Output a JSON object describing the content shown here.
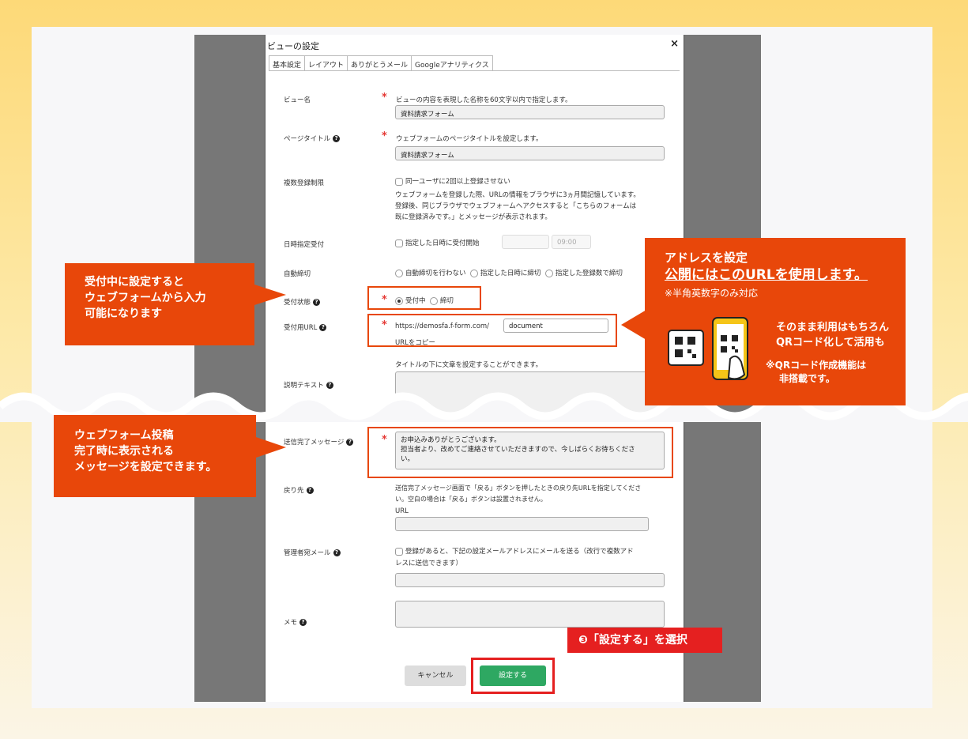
{
  "dialog": {
    "title": "ビューの設定",
    "close": "×"
  },
  "tabs": [
    "基本設定",
    "レイアウト",
    "ありがとうメール",
    "Googleアナリティクス"
  ],
  "fields": {
    "view_name": {
      "label": "ビュー名",
      "desc": "ビューの内容を表現した名称を60文字以内で指定します。",
      "value": "資料請求フォーム"
    },
    "page_title": {
      "label": "ページタイトル",
      "desc": "ウェブフォームのページタイトルを設定します。",
      "value": "資料請求フォーム"
    },
    "multi_reg": {
      "label": "複数登録制限",
      "check": "同一ユーザに2回以上登録させない",
      "desc1": "ウェブフォームを登録した際、URLの情報をブラウザに3ヵ月間記憶しています。",
      "desc2": "登録後、同じブラウザでウェブフォームへアクセスすると「こちらのフォームは",
      "desc3": "既に登録済みです。」とメッセージが表示されます。"
    },
    "date_accept": {
      "label": "日時指定受付",
      "check": "指定した日時に受付開始",
      "time": "09:00"
    },
    "auto_close": {
      "label": "自動締切",
      "opt1": "自動締切を行わない",
      "opt2": "指定した日時に締切",
      "opt3": "指定した登録数で締切"
    },
    "status": {
      "label": "受付状態",
      "opt1": "受付中",
      "opt2": "締切"
    },
    "url": {
      "label": "受付用URL",
      "prefix": "https://demosfa.f-form.com/",
      "value": "document",
      "copy": "URLをコピー"
    },
    "explain": {
      "label": "説明テキスト",
      "desc": "タイトルの下に文章を設定することができます。"
    },
    "complete_msg": {
      "label": "送信完了メッセージ",
      "line1": "お申込みありがとうございます。",
      "line2": "担当者より、改めてご連絡させていただきますので、今しばらくお待ちくださ",
      "line3": "い。"
    },
    "return": {
      "label": "戻り先",
      "desc1": "送信完了メッセージ画面で「戻る」ボタンを押したときの戻り先URLを指定してくださ",
      "desc2": "い。空白の場合は「戻る」ボタンは設置されません。",
      "sub": "URL"
    },
    "admin_mail": {
      "label": "管理者宛メール",
      "check": "登録があると、下記の設定メールアドレスにメールを送る（改行で複数アド",
      "check2": "レスに送信できます）"
    },
    "memo": {
      "label": "メモ"
    }
  },
  "buttons": {
    "cancel": "キャンセル",
    "submit": "設定する"
  },
  "annotations": {
    "a1": [
      "受付中に設定すると",
      "ウェブフォームから入力",
      "可能になります"
    ],
    "a2": [
      "ウェブフォーム投稿",
      "完了時に表示される",
      "メッセージを設定できます。"
    ],
    "a3": {
      "t1": "アドレスを設定",
      "t2": "公開にはこのURLを使用します。",
      "t3": "※半角英数字のみ対応",
      "t4": "そのまま利用はもちろん",
      "t5": "QRコード化して活用も",
      "t6": "※QRコード作成機能は",
      "t7": "非搭載です。"
    },
    "step": "❸「設定する」を選択"
  }
}
